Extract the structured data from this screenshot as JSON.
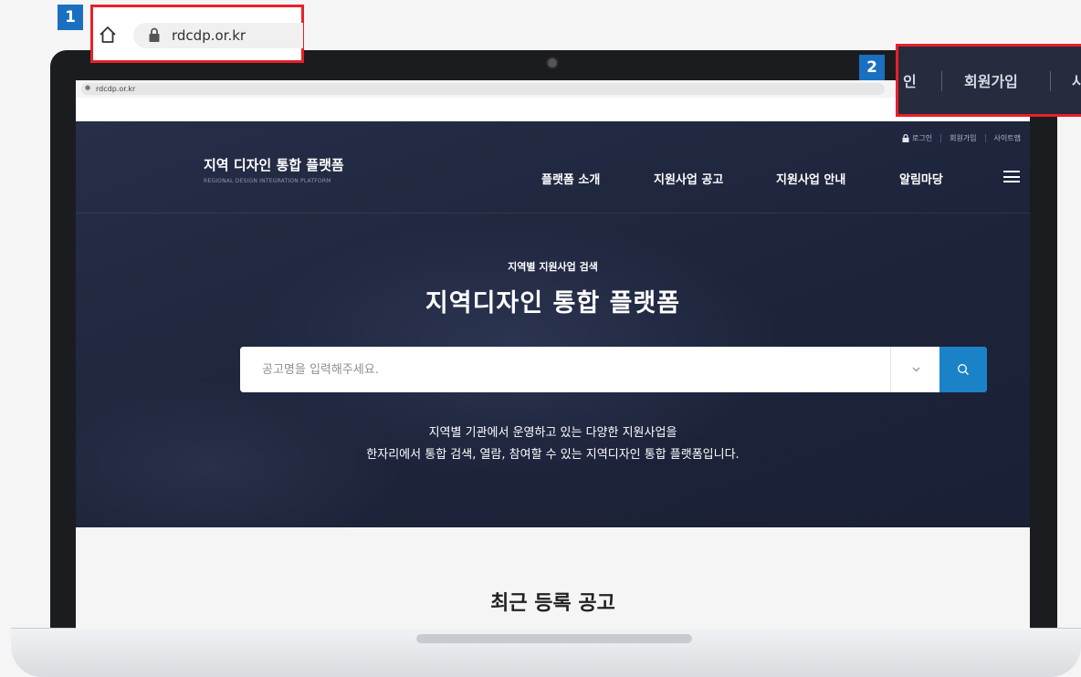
{
  "callout1": {
    "number": "1",
    "url": "rdcdp.or.kr",
    "icons": [
      "home-icon",
      "lock-icon"
    ]
  },
  "callout2": {
    "number": "2",
    "partial_login": "인",
    "signup": "회원가입",
    "partial_sitemap": "사"
  },
  "browser": {
    "url": "rdcdp.or.kr"
  },
  "header": {
    "util": {
      "login": "로그인",
      "signup": "회원가입",
      "sitemap": "사이트맵"
    },
    "logo_title": "지역 디자인 통합 플랫폼",
    "logo_subtitle": "REGIONAL DESIGN INTEGRATION PLATFORM",
    "nav": [
      "플랫폼 소개",
      "지원사업 공고",
      "지원사업 안내",
      "알림마당"
    ]
  },
  "hero": {
    "kicker": "지역별 지원사업 검색",
    "title": "지역디자인 통합 플랫폼",
    "search_placeholder": "공고명을 입력해주세요.",
    "desc_line1": "지역별 기관에서 운영하고 있는 다양한 지원사업을",
    "desc_line2": "한자리에서 통합 검색, 열람, 참여할 수 있는 지역디자인 통합 플랫폼입니다."
  },
  "recent": {
    "title": "최근 등록 공고"
  },
  "colors": {
    "hero_bg": "#1f2740",
    "search_button": "#1b82c7",
    "callout_border": "#e8202a",
    "badge": "#1b6fc0"
  }
}
